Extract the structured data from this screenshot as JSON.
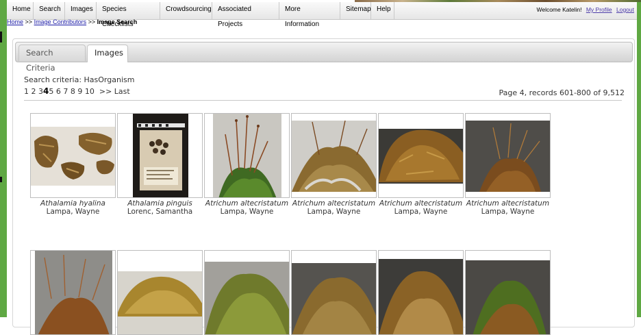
{
  "nav": {
    "items": [
      "Home",
      "Search",
      "Images",
      "Species Checklists",
      "Crowdsourcing",
      "Associated Projects",
      "More Information",
      "Sitemap",
      "Help"
    ],
    "welcome": "Welcome Katelin!",
    "profile": "My Profile",
    "logout": "Logout"
  },
  "breadcrumb": {
    "home": "Home",
    "sep1": ">>",
    "contributors": "Image Contributors",
    "sep2": ">>",
    "current": "Image Search"
  },
  "tabs": {
    "criteria": "Search Criteria",
    "images": "Images"
  },
  "search": {
    "criteria": "Search criteria: HasOrganism",
    "pages": [
      "1",
      "2",
      "3",
      "4",
      "5",
      "6",
      "7",
      "8",
      "9",
      "10"
    ],
    "current_page": "4",
    "next": ">>",
    "last": "Last",
    "records": "Page 4, records 601-800 of 9,512"
  },
  "thumbnails": [
    {
      "species": "Athalamia hyalina",
      "photographer": "Lampa, Wayne"
    },
    {
      "species": "Athalamia pinguis",
      "photographer": "Lorenc, Samantha"
    },
    {
      "species": "Atrichum altecristatum",
      "photographer": "Lampa, Wayne"
    },
    {
      "species": "Atrichum altecristatum",
      "photographer": "Lampa, Wayne"
    },
    {
      "species": "Atrichum altecristatum",
      "photographer": "Lampa, Wayne"
    },
    {
      "species": "Atrichum altecristatum",
      "photographer": "Lampa, Wayne"
    }
  ],
  "colors": {
    "frame": "#5fa843",
    "link": "#1a1aa6",
    "profile_link": "#4b3aa8"
  }
}
